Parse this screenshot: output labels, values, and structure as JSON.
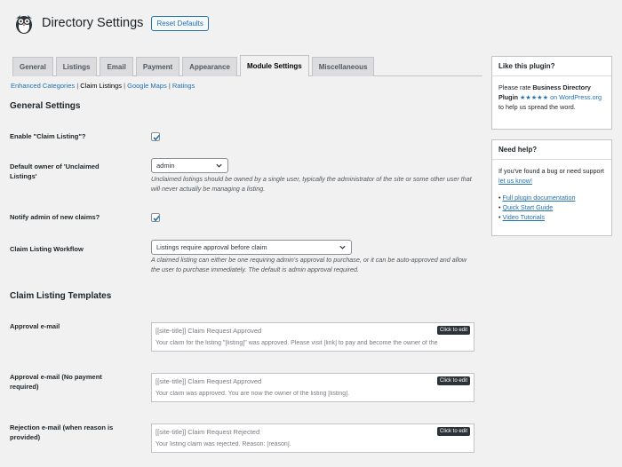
{
  "header": {
    "title": "Directory Settings",
    "reset_button": "Reset Defaults"
  },
  "tabs": [
    "General",
    "Listings",
    "Email",
    "Payment",
    "Appearance",
    "Module Settings",
    "Miscellaneous"
  ],
  "active_tab": "Module Settings",
  "subnav": {
    "items": [
      "Enhanced Categories",
      "Claim Listings",
      "Google Maps",
      "Ratings"
    ],
    "current": "Claim Listings",
    "separator": "|"
  },
  "general_settings": {
    "heading": "General Settings",
    "enable_claim": {
      "label": "Enable \"Claim Listing\"?",
      "checked": true
    },
    "default_owner": {
      "label": "Default owner of 'Unclaimed Listings'",
      "value": "admin",
      "description": "Unclaimed listings should be owned by a single user, typically the administrator of the site or some other user that will never actually be managing a listing."
    },
    "notify_admin": {
      "label": "Notify admin of new claims?",
      "checked": true
    },
    "workflow": {
      "label": "Claim Listing Workflow",
      "value": "Listings require approval before claim",
      "description": "A claimed listing can either be one requiring admin's approval to purchase, or it can be auto-approved and allow the user to purchase immediately. The default is admin approval required."
    }
  },
  "templates": {
    "heading": "Claim Listing Templates",
    "edit_label": "Click to edit",
    "items": [
      {
        "label": "Approval e-mail",
        "title": "[[site-title]] Claim Request Approved",
        "body": "Your claim for the listing \"[listing]\" was approved. Please visit [link] to pay and become the owner of the"
      },
      {
        "label": "Approval e-mail (No payment required)",
        "title": "[[site-title]] Claim Request Approved",
        "body": "Your claim was approved. You are now the owner of the listing [listing]."
      },
      {
        "label": "Rejection e-mail (when reason is provided)",
        "title": "[[site-title]] Claim Request Rejected",
        "body": "Your listing claim was rejected. Reason: [reason]."
      }
    ]
  },
  "sidebar": {
    "like": {
      "title": "Like this plugin?",
      "text_before": "Please rate ",
      "plugin_name": "Business Directory Plugin",
      "stars": "★★★★★",
      "link_text": " on WordPress.org",
      "text_after": " to help us spread the word."
    },
    "help": {
      "title": "Need help?",
      "text": "If you've found a bug or need support ",
      "link_text": "let us know!",
      "links": [
        "Full plugin documentation",
        "Quick Start Guide",
        "Video Tutorials"
      ],
      "bullet": "•"
    }
  },
  "colors": {
    "accent": "#2271b1",
    "checkbox_check": "#2271b1"
  }
}
